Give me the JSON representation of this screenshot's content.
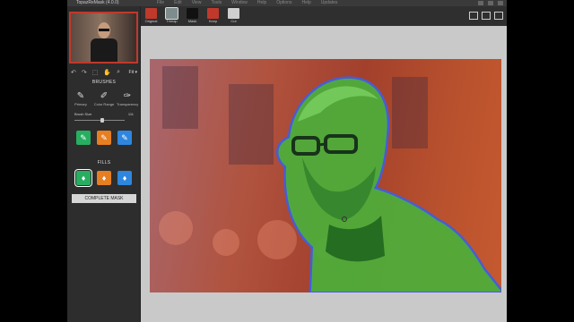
{
  "app": {
    "title": "TopazReMask (4.0.0)"
  },
  "menu": [
    "File",
    "Edit",
    "View",
    "Tools",
    "Window",
    "Help",
    "Options",
    "Help",
    "Updates"
  ],
  "toolbar": {
    "modes": [
      {
        "label": "Original",
        "color": "#c0392b"
      },
      {
        "label": "Trimap",
        "color": "#7f8c8d"
      },
      {
        "label": "Mask",
        "color": "#111111"
      },
      {
        "label": "Keep",
        "color": "#c0392b"
      },
      {
        "label": "Cut",
        "color": "#cfcfcf"
      }
    ],
    "active_mode": "Trimap"
  },
  "small_toolbar": {
    "fit_label": "Fit"
  },
  "brushes": {
    "title": "BRUSHES",
    "items": [
      {
        "label": "Primary",
        "icon": "primary-brush-icon"
      },
      {
        "label": "Color Range",
        "icon": "color-range-brush-icon"
      },
      {
        "label": "Transparency",
        "icon": "transparency-brush-icon"
      }
    ],
    "size_label": "Brush Size",
    "size_value": "111",
    "slider_fraction": 0.55,
    "mode_buttons": [
      {
        "icon": "keep-brush-icon",
        "color": "#27ae60"
      },
      {
        "icon": "cut-brush-icon",
        "color": "#e67e22"
      },
      {
        "icon": "compute-brush-icon",
        "color": "#2e86de"
      }
    ]
  },
  "fills": {
    "title": "FILLS",
    "buttons": [
      {
        "icon": "keep-fill-icon",
        "color": "#27ae60",
        "selected": true
      },
      {
        "icon": "cut-fill-icon",
        "color": "#e67e22",
        "selected": false
      },
      {
        "icon": "compute-fill-icon",
        "color": "#2e86de",
        "selected": false
      }
    ]
  },
  "complete_mask_label": "COMPLETE MASK",
  "colors": {
    "keep": "#27ae60",
    "cut": "#e67e22",
    "compute": "#2e86de"
  }
}
